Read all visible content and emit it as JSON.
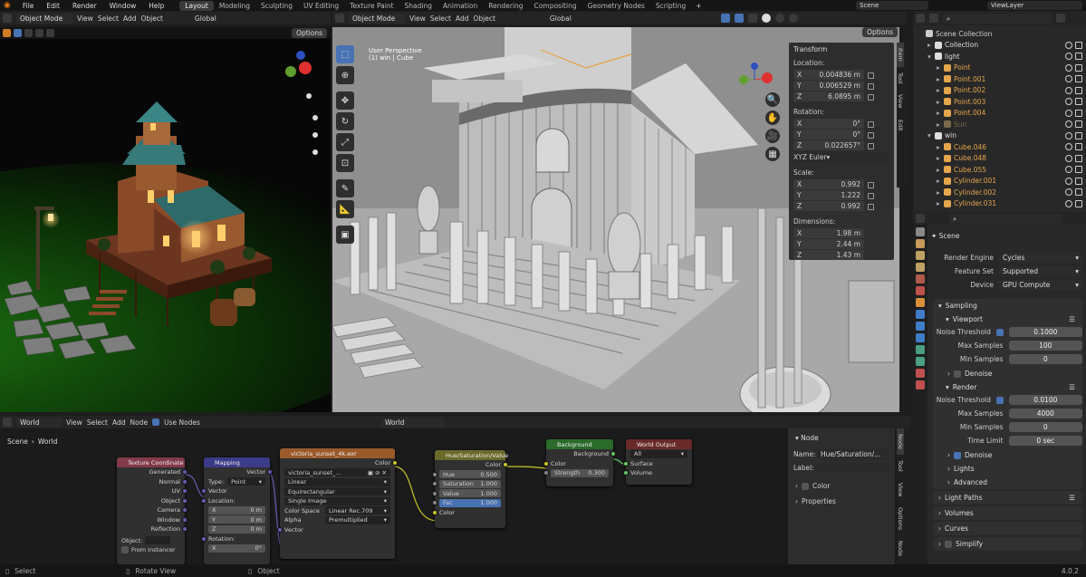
{
  "topbar": {
    "menus": [
      "File",
      "Edit",
      "Render",
      "Window",
      "Help"
    ],
    "workspaces": [
      "Layout",
      "Modeling",
      "Sculpting",
      "UV Editing",
      "Texture Paint",
      "Shading",
      "Animation",
      "Rendering",
      "Compositing",
      "Geometry Nodes",
      "Scripting"
    ],
    "active_workspace": "Layout",
    "scene": "Scene",
    "view_layer": "ViewLayer"
  },
  "left_viewport": {
    "mode": "Object Mode",
    "menus": [
      "View",
      "Select",
      "Add",
      "Object"
    ],
    "transform": "Global",
    "options": "Options"
  },
  "main_viewport": {
    "mode": "Object Mode",
    "menus": [
      "View",
      "Select",
      "Add",
      "Object"
    ],
    "transform": "Global",
    "options": "Options",
    "info_line1": "User Perspective",
    "info_line2": "(1) win | Cube",
    "side_tabs": [
      "Item",
      "Tool",
      "View",
      "Edit"
    ]
  },
  "transform_panel": {
    "title": "Transform",
    "location_label": "Location:",
    "location": [
      {
        "axis": "X",
        "value": "0.004836 m"
      },
      {
        "axis": "Y",
        "value": "0.006529 m"
      },
      {
        "axis": "Z",
        "value": "6.0895 m"
      }
    ],
    "rotation_label": "Rotation:",
    "rotation": [
      {
        "axis": "X",
        "value": "0°"
      },
      {
        "axis": "Y",
        "value": "0°"
      },
      {
        "axis": "Z",
        "value": "0.022657°"
      }
    ],
    "rotation_mode": "XYZ Euler",
    "scale_label": "Scale:",
    "scale": [
      {
        "axis": "X",
        "value": "0.992"
      },
      {
        "axis": "Y",
        "value": "1.222"
      },
      {
        "axis": "Z",
        "value": "0.992"
      }
    ],
    "dimensions_label": "Dimensions:",
    "dimensions": [
      {
        "axis": "X",
        "value": "1.98 m"
      },
      {
        "axis": "Y",
        "value": "2.44 m"
      },
      {
        "axis": "Z",
        "value": "1.43 m"
      }
    ]
  },
  "outliner": {
    "rows": [
      {
        "label": "Scene Collection",
        "indent": 0,
        "color": "#cccccc",
        "arrow": "",
        "vis": false
      },
      {
        "label": "Collection",
        "indent": 1,
        "color": "#dddddd",
        "arrow": "▸",
        "vis": true
      },
      {
        "label": "light",
        "indent": 1,
        "color": "#dddddd",
        "arrow": "▾",
        "vis": true
      },
      {
        "label": "Point",
        "indent": 2,
        "color": "#e6a64b",
        "arrow": "▸",
        "vis": true
      },
      {
        "label": "Point.001",
        "indent": 2,
        "color": "#e6a64b",
        "arrow": "▸",
        "vis": true
      },
      {
        "label": "Point.002",
        "indent": 2,
        "color": "#e6a64b",
        "arrow": "▸",
        "vis": true
      },
      {
        "label": "Point.003",
        "indent": 2,
        "color": "#e6a64b",
        "arrow": "▸",
        "vis": true
      },
      {
        "label": "Point.004",
        "indent": 2,
        "color": "#e6a64b",
        "arrow": "▸",
        "vis": true
      },
      {
        "label": "Sun",
        "indent": 2,
        "color": "#7a6a4a",
        "arrow": "▸",
        "vis": true
      },
      {
        "label": "win",
        "indent": 1,
        "color": "#dddddd",
        "arrow": "▾",
        "vis": true
      },
      {
        "label": "Cube.046",
        "indent": 2,
        "color": "#e6a64b",
        "arrow": "▸",
        "vis": true
      },
      {
        "label": "Cube.048",
        "indent": 2,
        "color": "#e6a64b",
        "arrow": "▸",
        "vis": true
      },
      {
        "label": "Cube.055",
        "indent": 2,
        "color": "#e6a64b",
        "arrow": "▸",
        "vis": true
      },
      {
        "label": "Cylinder.001",
        "indent": 2,
        "color": "#e6a64b",
        "arrow": "▸",
        "vis": true
      },
      {
        "label": "Cylinder.002",
        "indent": 2,
        "color": "#e6a64b",
        "arrow": "▸",
        "vis": true
      },
      {
        "label": "Cylinder.031",
        "indent": 2,
        "color": "#e6a64b",
        "arrow": "▸",
        "vis": true
      }
    ]
  },
  "properties": {
    "breadcrumb": "Scene",
    "render_engine_label": "Render Engine",
    "render_engine": "Cycles",
    "feature_set_label": "Feature Set",
    "feature_set": "Supported",
    "device_label": "Device",
    "device": "GPU Compute",
    "sampling": "Sampling",
    "viewport": "Viewport",
    "noise_threshold_label": "Noise Threshold",
    "vp_noise": "0.1000",
    "max_samples_label": "Max Samples",
    "vp_max": "100",
    "min_samples_label": "Min Samples",
    "vp_min": "0",
    "denoise": "Denoise",
    "render": "Render",
    "r_noise": "0.0100",
    "r_max": "4000",
    "r_min": "0",
    "time_limit_label": "Time Limit",
    "time_limit": "0 sec",
    "lights": "Lights",
    "advanced": "Advanced",
    "light_paths": "Light Paths",
    "volumes": "Volumes",
    "curves": "Curves",
    "simplify": "Simplify"
  },
  "node_editor": {
    "type": "World",
    "menus": [
      "View",
      "Select",
      "Add",
      "Node"
    ],
    "use_nodes": "Use Nodes",
    "world_name": "World",
    "breadcrumb_scene": "Scene",
    "breadcrumb_world": "World",
    "texcoord": {
      "title": "Texture Coordinate",
      "outputs": [
        "Generated",
        "Normal",
        "UV",
        "Object",
        "Camera",
        "Window",
        "Reflection"
      ],
      "object_label": "Object:",
      "extra": "From Instancer"
    },
    "mapping": {
      "title": "Mapping",
      "output": "Vector",
      "type_label": "Type:",
      "type": "Point",
      "vector": "Vector",
      "location": "Location:",
      "x": "X",
      "y": "Y",
      "z": "Z",
      "loc_values": [
        "0 m",
        "0 m",
        "0 m"
      ],
      "rotation": "Rotation:",
      "rot_x": "0°"
    },
    "envtex": {
      "title": "victoria_sunset_4k.exr",
      "color": "Color",
      "image": "victoria_sunset_...",
      "interp": "Linear",
      "proj": "Equirectangular",
      "single": "Single Image",
      "cs_label": "Color Space",
      "cs": "Linear Rec.709",
      "alpha_label": "Alpha",
      "alpha": "Premultiplied",
      "vector": "Vector"
    },
    "hsv": {
      "title": "Hue/Saturation/Value",
      "color": "Color",
      "hue": "Hue",
      "hue_v": "0.500",
      "sat": "Saturation",
      "sat_v": "1.000",
      "val": "Value",
      "val_v": "1.000",
      "fac": "Fac",
      "fac_v": "1.000",
      "in_color": "Color"
    },
    "background": {
      "title": "Background",
      "out": "Background",
      "color": "Color",
      "strength": "Strength",
      "strength_v": "0.300"
    },
    "output": {
      "title": "World Output",
      "target": "All",
      "surface": "Surface",
      "volume": "Volume"
    }
  },
  "node_sidebar": {
    "title": "Node",
    "name_label": "Name:",
    "name": "Hue/Saturation/...",
    "label_label": "Label:",
    "color": "Color",
    "properties": "Properties",
    "tabs": [
      "Node",
      "Tool",
      "View",
      "Options",
      "Node"
    ]
  },
  "status": {
    "select": "Select",
    "rotate": "Rotate View",
    "object": "Object",
    "version": "4.0.2"
  }
}
